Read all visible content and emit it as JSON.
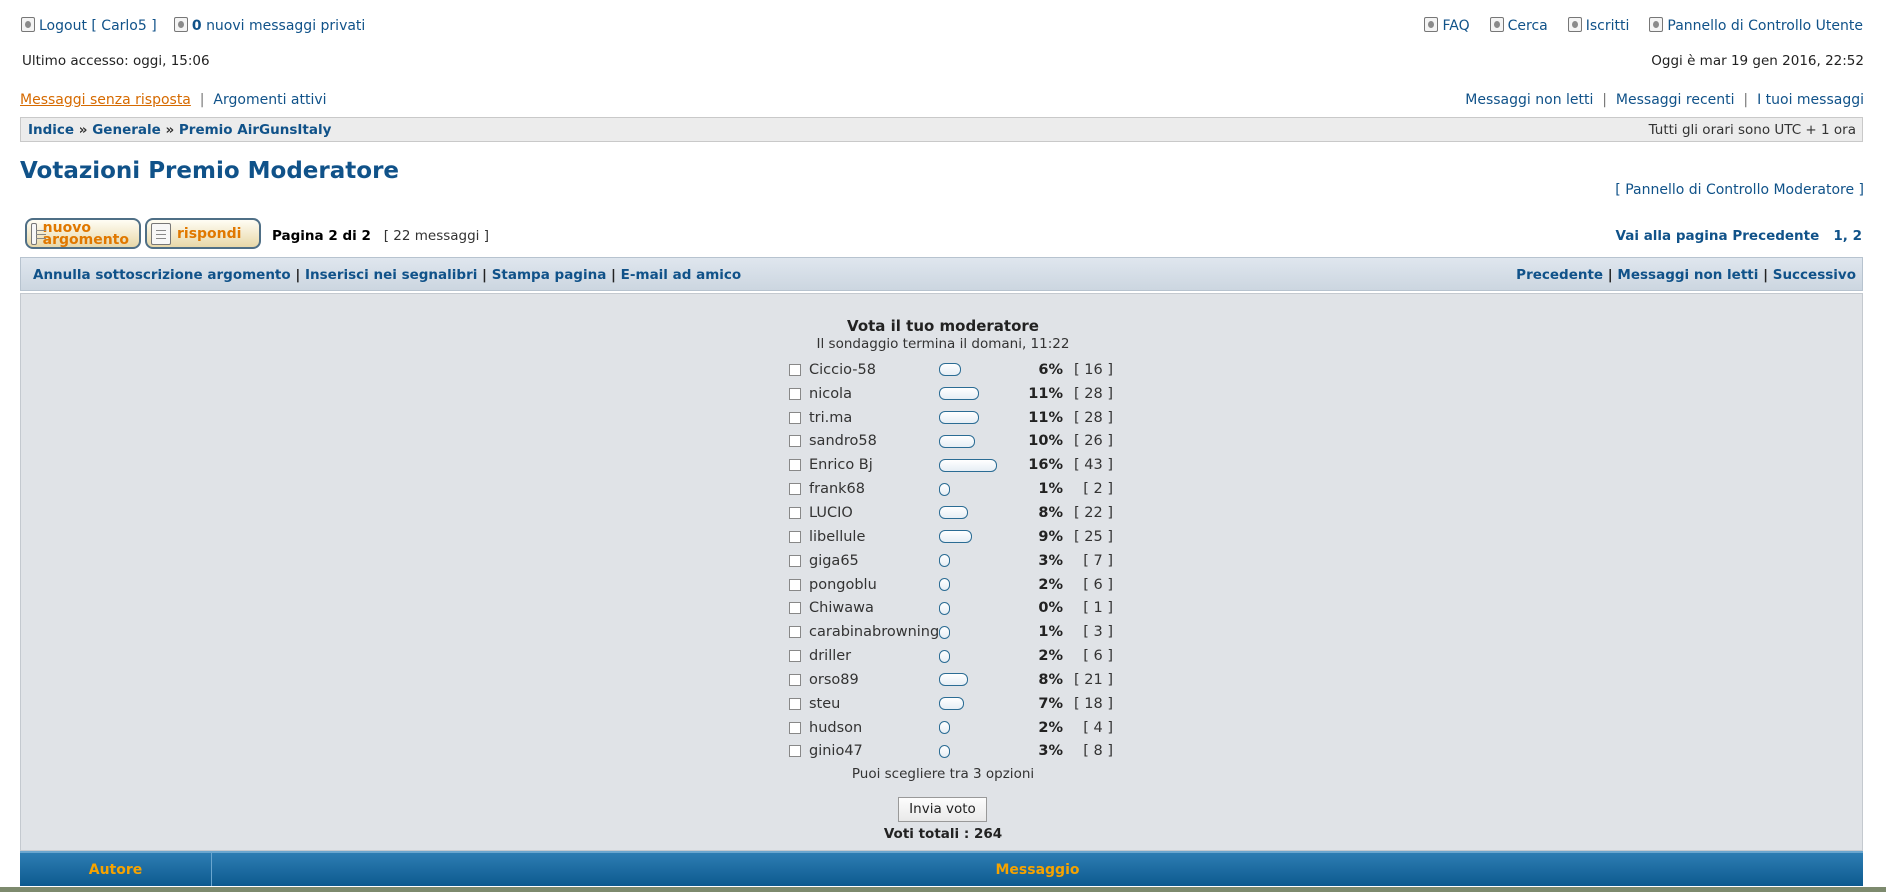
{
  "header": {
    "logout_label": "Logout [ Carlo5 ]",
    "pm_count": "0",
    "pm_label": "nuovi messaggi privati",
    "nav": [
      "FAQ",
      "Cerca",
      "Iscritti",
      "Pannello di Controllo Utente"
    ]
  },
  "status": {
    "last_access": "Ultimo accesso: oggi, 15:06",
    "today": "Oggi è mar 19 gen 2016, 22:52"
  },
  "quicklinks": {
    "unanswered": "Messaggi senza risposta",
    "active": "Argomenti attivi",
    "unread": "Messaggi non letti",
    "recent": "Messaggi recenti",
    "mine": "I tuoi messaggi"
  },
  "breadcrumb": {
    "items": [
      "Indice",
      "Generale",
      "Premio AirGunsItaly"
    ],
    "timezone": "Tutti gli orari sono UTC + 1 ora"
  },
  "topic": {
    "title": "Votazioni Premio Moderatore",
    "mcp_link": "Pannello di Controllo Moderatore",
    "new_topic_label": "nuovo argomento",
    "reply_label": "rispondi",
    "page_info": "Pagina 2 di 2",
    "post_count": "[ 22 messaggi ]",
    "jump_label": "Vai alla pagina",
    "jump_prev": "Precedente",
    "jump_pages": "1, 2"
  },
  "actions": {
    "left": [
      "Annulla sottoscrizione argomento",
      "Inserisci nei segnalibri",
      "Stampa pagina",
      "E-mail ad amico"
    ],
    "right": [
      "Precedente",
      "Messaggi non letti",
      "Successivo"
    ]
  },
  "poll": {
    "title": "Vota il tuo moderatore",
    "ends": "Il sondaggio termina il domani, 11:22",
    "options": [
      {
        "name": "Ciccio-58",
        "percent": 6,
        "pct_label": "6%",
        "votes": "[ 16 ]"
      },
      {
        "name": "nicola",
        "percent": 11,
        "pct_label": "11%",
        "votes": "[ 28 ]"
      },
      {
        "name": "tri.ma",
        "percent": 11,
        "pct_label": "11%",
        "votes": "[ 28 ]"
      },
      {
        "name": "sandro58",
        "percent": 10,
        "pct_label": "10%",
        "votes": "[ 26 ]"
      },
      {
        "name": "Enrico Bj",
        "percent": 16,
        "pct_label": "16%",
        "votes": "[ 43 ]"
      },
      {
        "name": "frank68",
        "percent": 1,
        "pct_label": "1%",
        "votes": "[ 2 ]"
      },
      {
        "name": "LUCIO",
        "percent": 8,
        "pct_label": "8%",
        "votes": "[ 22 ]"
      },
      {
        "name": "libellule",
        "percent": 9,
        "pct_label": "9%",
        "votes": "[ 25 ]"
      },
      {
        "name": "giga65",
        "percent": 3,
        "pct_label": "3%",
        "votes": "[ 7 ]"
      },
      {
        "name": "pongoblu",
        "percent": 2,
        "pct_label": "2%",
        "votes": "[ 6 ]"
      },
      {
        "name": "Chiwawa",
        "percent": 0,
        "pct_label": "0%",
        "votes": "[ 1 ]"
      },
      {
        "name": "carabinabrowning",
        "percent": 1,
        "pct_label": "1%",
        "votes": "[ 3 ]"
      },
      {
        "name": "driller",
        "percent": 2,
        "pct_label": "2%",
        "votes": "[ 6 ]"
      },
      {
        "name": "orso89",
        "percent": 8,
        "pct_label": "8%",
        "votes": "[ 21 ]"
      },
      {
        "name": "steu",
        "percent": 7,
        "pct_label": "7%",
        "votes": "[ 18 ]"
      },
      {
        "name": "hudson",
        "percent": 2,
        "pct_label": "2%",
        "votes": "[ 4 ]"
      },
      {
        "name": "ginio47",
        "percent": 3,
        "pct_label": "3%",
        "votes": "[ 8 ]"
      }
    ],
    "max_choices": "Puoi scegliere tra 3 opzioni",
    "submit_label": "Invia voto",
    "total": "Voti totali : 264"
  },
  "posts_header": {
    "author": "Autore",
    "message": "Messaggio"
  }
}
